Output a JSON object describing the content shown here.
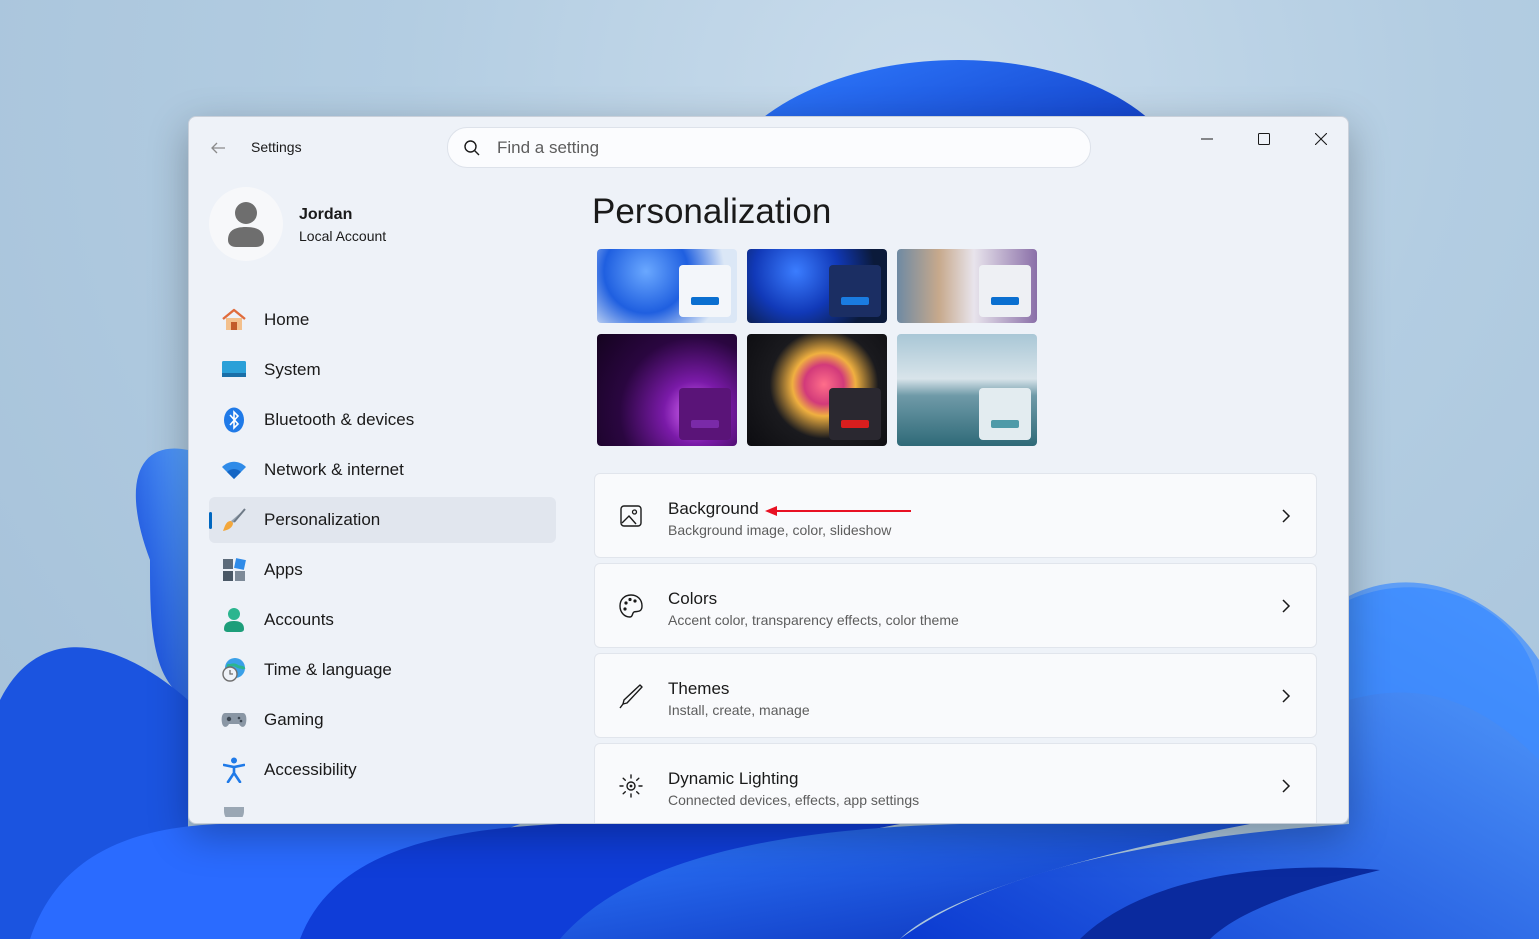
{
  "window": {
    "app_title": "Settings",
    "search_placeholder": "Find a setting"
  },
  "profile": {
    "name": "Jordan",
    "account_type": "Local Account"
  },
  "nav": {
    "items": [
      {
        "label": "Home",
        "icon": "home-icon"
      },
      {
        "label": "System",
        "icon": "system-icon"
      },
      {
        "label": "Bluetooth & devices",
        "icon": "bluetooth-icon"
      },
      {
        "label": "Network & internet",
        "icon": "wifi-icon"
      },
      {
        "label": "Personalization",
        "icon": "brush-icon",
        "active": true
      },
      {
        "label": "Apps",
        "icon": "apps-icon"
      },
      {
        "label": "Accounts",
        "icon": "person-icon"
      },
      {
        "label": "Time & language",
        "icon": "globe-clock-icon"
      },
      {
        "label": "Gaming",
        "icon": "gamepad-icon"
      },
      {
        "label": "Accessibility",
        "icon": "accessibility-icon"
      }
    ]
  },
  "main": {
    "title": "Personalization",
    "cards": [
      {
        "title": "Background",
        "subtitle": "Background image, color, slideshow",
        "icon": "image-icon"
      },
      {
        "title": "Colors",
        "subtitle": "Accent color, transparency effects, color theme",
        "icon": "palette-icon"
      },
      {
        "title": "Themes",
        "subtitle": "Install, create, manage",
        "icon": "pen-icon"
      },
      {
        "title": "Dynamic Lighting",
        "subtitle": "Connected devices, effects, app settings",
        "icon": "lighting-icon"
      }
    ]
  },
  "colors": {
    "accent": "#0067c0",
    "annotation_arrow": "#e81123"
  }
}
